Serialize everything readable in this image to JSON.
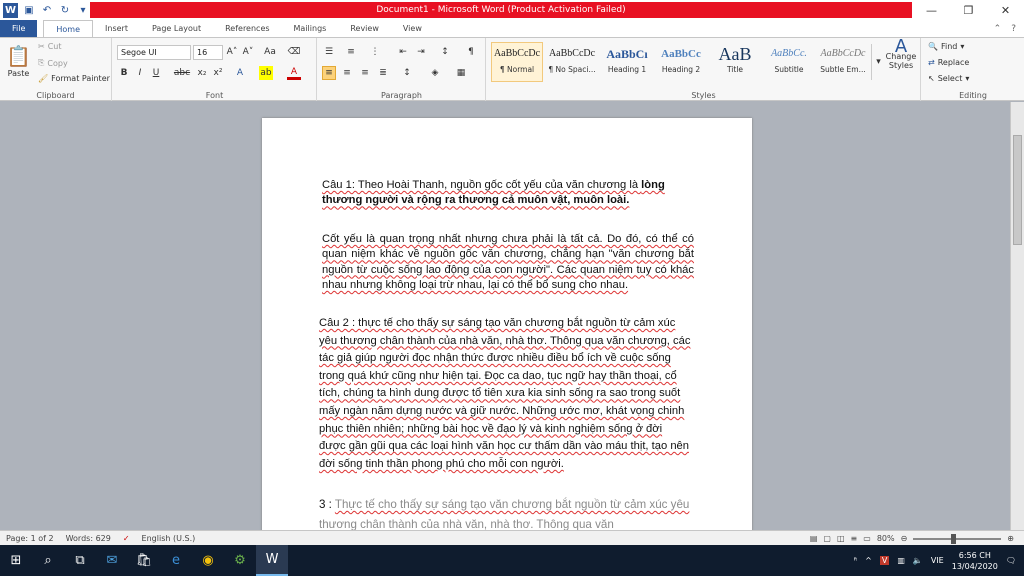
{
  "window": {
    "title": "Document1  -  Microsoft Word (Product Activation Failed)",
    "colors": {
      "title_bg": "#e81123",
      "word_blue": "#2b579a"
    }
  },
  "tabs": [
    "File",
    "Home",
    "Insert",
    "Page Layout",
    "References",
    "Mailings",
    "Review",
    "View"
  ],
  "active_tab": "Home",
  "clipboard": {
    "paste": "Paste",
    "cut": "Cut",
    "copy": "Copy",
    "format_painter": "Format Painter",
    "label": "Clipboard"
  },
  "font": {
    "name": "Segoe UI",
    "size": "16",
    "label": "Font"
  },
  "paragraph": {
    "label": "Paragraph"
  },
  "styles": {
    "items": [
      {
        "sample": "AaBbCcDc",
        "name": "¶ Normal"
      },
      {
        "sample": "AaBbCcDc",
        "name": "¶ No Spaci..."
      },
      {
        "sample": "AaBbCı",
        "name": "Heading 1"
      },
      {
        "sample": "AaBbCc",
        "name": "Heading 2"
      },
      {
        "sample": "AaB",
        "name": "Title"
      },
      {
        "sample": "AaBbCc.",
        "name": "Subtitle"
      },
      {
        "sample": "AaBbCcDc",
        "name": "Subtle Em..."
      }
    ],
    "change_styles": "Change Styles",
    "label": "Styles"
  },
  "editing": {
    "find": "Find",
    "replace": "Replace",
    "select": "Select",
    "label": "Editing"
  },
  "document": {
    "p1_start": "Câu 1: Theo Hoài Thanh, nguồn gốc cốt yếu của văn chương là ",
    "p1_bold": "lòng thương người và rộng ra thương cả muôn vật, muôn loài.",
    "p2": "Cốt yếu là quan trọng nhất nhưng chưa phải là tất cả. Do đó, có thể có quan niệm khác về nguồn gốc văn chương, chẳng hạn \"văn chương bắt nguồn từ cuộc sống lao động của con người\". Các quan niệm tuy có khác nhau nhưng không loại trừ nhau, lại có thể bổ sung cho nhau.",
    "p3": "Câu 2 : thực tế cho thấy sự sáng tạo văn chương bắt nguồn từ cảm xúc yêu thương chân thành của nhà văn, nhà thơ. Thông qua văn chương, các tác giả giúp người đọc nhận thức được nhiều điều bổ ích về cuộc sống trong quá khứ cũng như hiện tại. Đọc ca dao, tục ngữ hay thần thoại, cổ tích, chúng ta hình dung được tổ tiên xưa kia sinh sống ra sao trong suốt mấy ngàn năm dựng nước và giữ nước. Những ước mơ, khát vọng chinh phục thiên nhiên; những bài học về đạo lý và kinh nghiệm sống ở đời được gần gũi qua các loại hình văn học cư thấm dần vào máu thịt, tạo nên đời sống tinh thần phong phú cho mỗi con người.",
    "p4_num": "3 : ",
    "p4": "Thực tế cho thấy sự sáng tạo văn chương bắt nguồn từ cảm xúc yêu thương chân thành của nhà văn, nhà thơ. Thông qua văn"
  },
  "status": {
    "page": "Page: 1 of 2",
    "words": "Words: 629",
    "language": "English (U.S.)",
    "zoom": "80%",
    "zoom_level": 0.8
  },
  "tray": {
    "lang": "VIE",
    "time": "6:56 CH",
    "date": "13/04/2020"
  }
}
